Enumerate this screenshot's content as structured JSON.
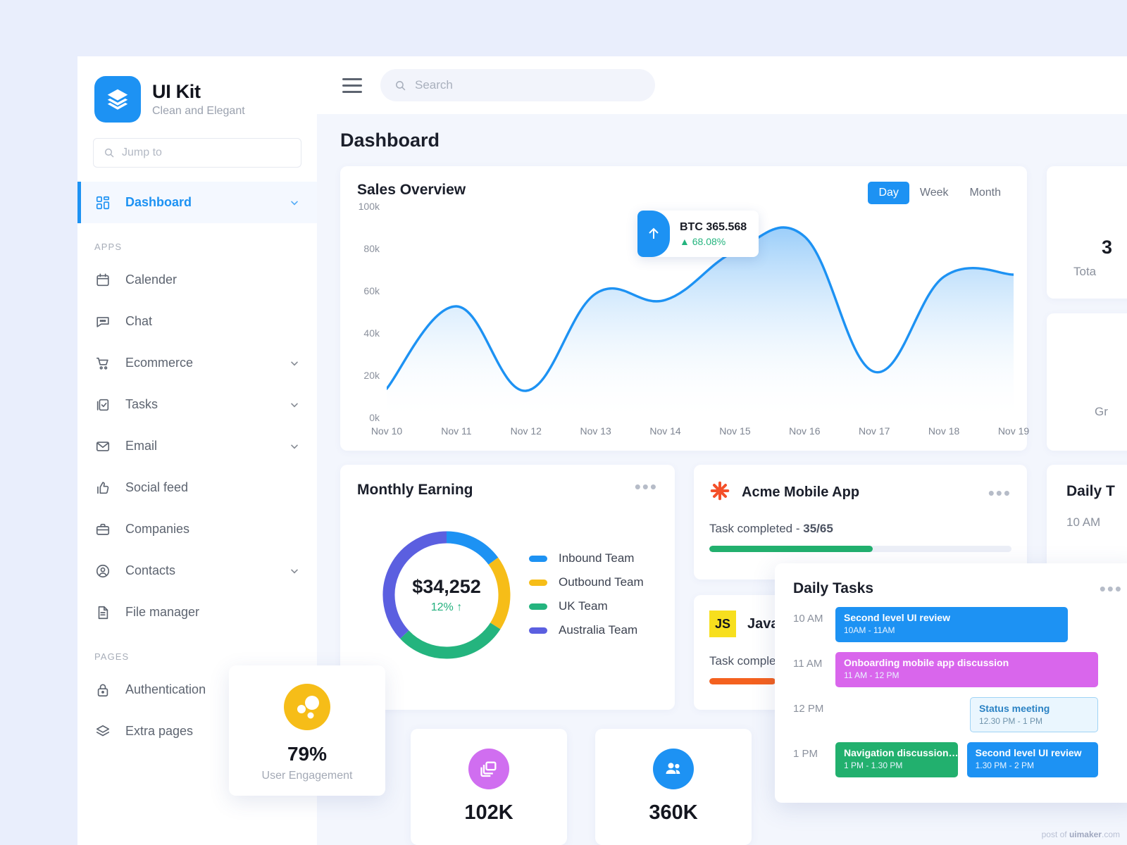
{
  "brand": {
    "title": "UI Kit",
    "subtitle": "Clean and Elegant",
    "logo_icon": "layers-icon",
    "accent": "#1d92f3"
  },
  "sidebar": {
    "jump": {
      "placeholder": "Jump to",
      "icon": "search-icon"
    },
    "primary": [
      {
        "label": "Dashboard",
        "icon": "grid-icon",
        "chevron": true,
        "active": true
      }
    ],
    "sections": [
      {
        "title": "APPS",
        "items": [
          {
            "label": "Calender",
            "icon": "calendar-icon",
            "chevron": false
          },
          {
            "label": "Chat",
            "icon": "chat-icon",
            "chevron": false
          },
          {
            "label": "Ecommerce",
            "icon": "cart-icon",
            "chevron": true
          },
          {
            "label": "Tasks",
            "icon": "task-check-icon",
            "chevron": true
          },
          {
            "label": "Email",
            "icon": "envelope-icon",
            "chevron": true
          },
          {
            "label": "Social feed",
            "icon": "thumbs-up-icon",
            "chevron": false
          },
          {
            "label": "Companies",
            "icon": "briefcase-icon",
            "chevron": false
          },
          {
            "label": "Contacts",
            "icon": "user-circle-icon",
            "chevron": true
          },
          {
            "label": "File manager",
            "icon": "document-icon",
            "chevron": false
          }
        ]
      },
      {
        "title": "PAGES",
        "items": [
          {
            "label": "Authentication",
            "icon": "lock-icon",
            "chevron": false
          },
          {
            "label": "Extra pages",
            "icon": "stack-icon",
            "chevron": false
          }
        ]
      }
    ]
  },
  "topbar": {
    "menu_icon": "hamburger-icon",
    "search": {
      "placeholder": "Search",
      "icon": "search-icon"
    }
  },
  "page": {
    "title": "Dashboard"
  },
  "sales": {
    "title": "Sales Overview",
    "ranges": [
      {
        "label": "Day",
        "selected": true
      },
      {
        "label": "Week",
        "selected": false
      },
      {
        "label": "Month",
        "selected": false
      }
    ],
    "tooltip": {
      "icon": "arrow-up-icon",
      "value": "BTC 365.568",
      "change": "68.08%",
      "direction": "▲",
      "change_color": "#24b47e"
    }
  },
  "earning": {
    "title": "Monthly Earning",
    "menu_icon": "more-horizontal-icon",
    "total": "$34,252",
    "delta": "12%",
    "delta_arrow": "↑",
    "legend": [
      {
        "label": "Inbound Team",
        "color": "#1d92f3"
      },
      {
        "label": "Outbound Team",
        "color": "#f6bd18"
      },
      {
        "label": "UK Team",
        "color": "#24b47e"
      },
      {
        "label": "Australia Team",
        "color": "#5b5fe0"
      }
    ]
  },
  "projects": [
    {
      "name": "Acme Mobile App",
      "icon": "asterisk-icon",
      "icon_color": "#f4502a",
      "menu_icon": "more-horizontal-icon",
      "status_prefix": "Task completed - ",
      "status_value": "35/65",
      "progress_pct": 54,
      "progress_color": "#22b06e"
    },
    {
      "name": "Javas",
      "icon": "js-badge-icon",
      "icon_color": "#f7df1e",
      "status_prefix": "Task complet",
      "status_value": "",
      "progress_pct": 22,
      "progress_color": "#f4611f"
    }
  ],
  "right_cards": [
    {
      "number": "3",
      "label": "Tota"
    },
    {
      "label": "Gr"
    },
    {
      "title": "Daily T",
      "first_time": "10 AM"
    }
  ],
  "daily_tasks": {
    "title": "Daily Tasks",
    "menu_icon": "more-horizontal-icon",
    "rows": [
      {
        "time": "10 AM",
        "events": [
          {
            "title": "Second level UI review",
            "time": "10AM - 11AM",
            "color": "#1d92f3",
            "style": "solid",
            "left_pct": 0,
            "width_pct": 76
          }
        ]
      },
      {
        "time": "11 AM",
        "events": [
          {
            "title": "Onboarding mobile app discussion",
            "time": "11 AM - 12 PM",
            "color": "#d966ec",
            "style": "solid",
            "left_pct": 0,
            "width_pct": 86
          }
        ]
      },
      {
        "time": "12 PM",
        "events": [
          {
            "title": "Status meeting",
            "time": "12.30 PM - 1 PM",
            "color": "#eaf6fe",
            "style": "outline",
            "left_pct": 44,
            "width_pct": 42
          }
        ]
      },
      {
        "time": "1 PM",
        "events": [
          {
            "title": "Navigation discussion…",
            "time": "1 PM - 1.30 PM",
            "color": "#22b06e",
            "style": "solid",
            "left_pct": 0,
            "width_pct": 40
          },
          {
            "title": "Second level UI review",
            "time": "1.30 PM - 2 PM",
            "color": "#1d92f3",
            "style": "solid",
            "left_pct": 43,
            "width_pct": 43
          }
        ]
      }
    ]
  },
  "engagement": {
    "icon": "bubbles-icon",
    "icon_color": "#f6bd18",
    "percent": "79%",
    "label": "User Engagement"
  },
  "stats": [
    {
      "number": "102K",
      "icon": "layers-copy-icon",
      "icon_color": "#d06ef0"
    },
    {
      "number": "360K",
      "icon": "users-icon",
      "icon_color": "#1d92f3"
    }
  ],
  "watermark": {
    "prefix": "post of ",
    "brand": "uimaker",
    "suffix": ".com"
  },
  "chart_data": {
    "type": "area",
    "title": "Sales Overview",
    "xlabel": "",
    "ylabel": "",
    "ylim": [
      0,
      100000
    ],
    "yticks": [
      0,
      20000,
      40000,
      60000,
      80000,
      100000
    ],
    "ytick_labels": [
      "0k",
      "20k",
      "40k",
      "60k",
      "80k",
      "100k"
    ],
    "categories": [
      "Nov 10",
      "Nov 11",
      "Nov 12",
      "Nov 13",
      "Nov 14",
      "Nov 15",
      "Nov 16",
      "Nov 17",
      "Nov 18",
      "Nov 19"
    ],
    "values": [
      14000,
      53000,
      13000,
      59000,
      56000,
      79000,
      86000,
      22000,
      67000,
      68000
    ],
    "grid": false,
    "legend": "none",
    "line_color": "#1d92f3",
    "fill": "gradient-blue-to-transparent",
    "highlight_point": {
      "x": "Nov 15",
      "y": 79000,
      "label": "BTC 365.568",
      "change": "68.08%"
    }
  },
  "donut_data": {
    "type": "pie",
    "title": "Monthly Earning",
    "center_label": "$34,252",
    "labels": [
      "Inbound Team",
      "Outbound Team",
      "UK Team",
      "Australia Team"
    ],
    "values": [
      15,
      19,
      29,
      37
    ],
    "colors": [
      "#1d92f3",
      "#f6bd18",
      "#24b47e",
      "#5b5fe0"
    ]
  }
}
